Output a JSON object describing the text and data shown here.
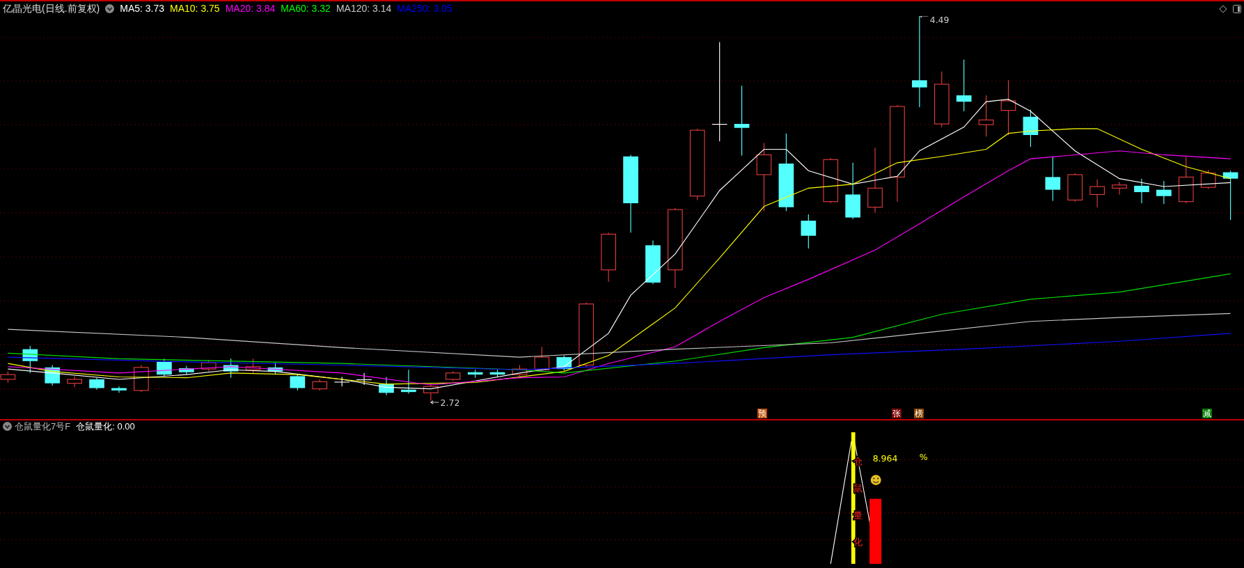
{
  "header": {
    "title": "亿晶光电(日线.前复权)",
    "moving_averages": [
      {
        "label": "MA5: 3.73",
        "color": "#ffffff"
      },
      {
        "label": "MA10: 3.75",
        "color": "#ffff00"
      },
      {
        "label": "MA20: 3.84",
        "color": "#ff00ff"
      },
      {
        "label": "MA60: 3.32",
        "color": "#00ff00"
      },
      {
        "label": "MA120: 3.14",
        "color": "#c8c8c8"
      },
      {
        "label": "MA250: 3.05",
        "color": "#0000ff"
      }
    ]
  },
  "price_chart": {
    "high_label": "4.49",
    "low_label": "2.72",
    "signals": [
      {
        "text": "预",
        "color": "#b84a00"
      },
      {
        "text": "张",
        "color": "#7a0000"
      },
      {
        "text": "榜",
        "color": "#8a4500"
      },
      {
        "text": "减",
        "color": "#007a00"
      }
    ]
  },
  "indicator": {
    "name": "仓鼠量化7号F",
    "reading": "仓鼠量化: 0.00",
    "value": "8.964",
    "unit": "%",
    "vertical_text": "仓鼠量化"
  }
}
